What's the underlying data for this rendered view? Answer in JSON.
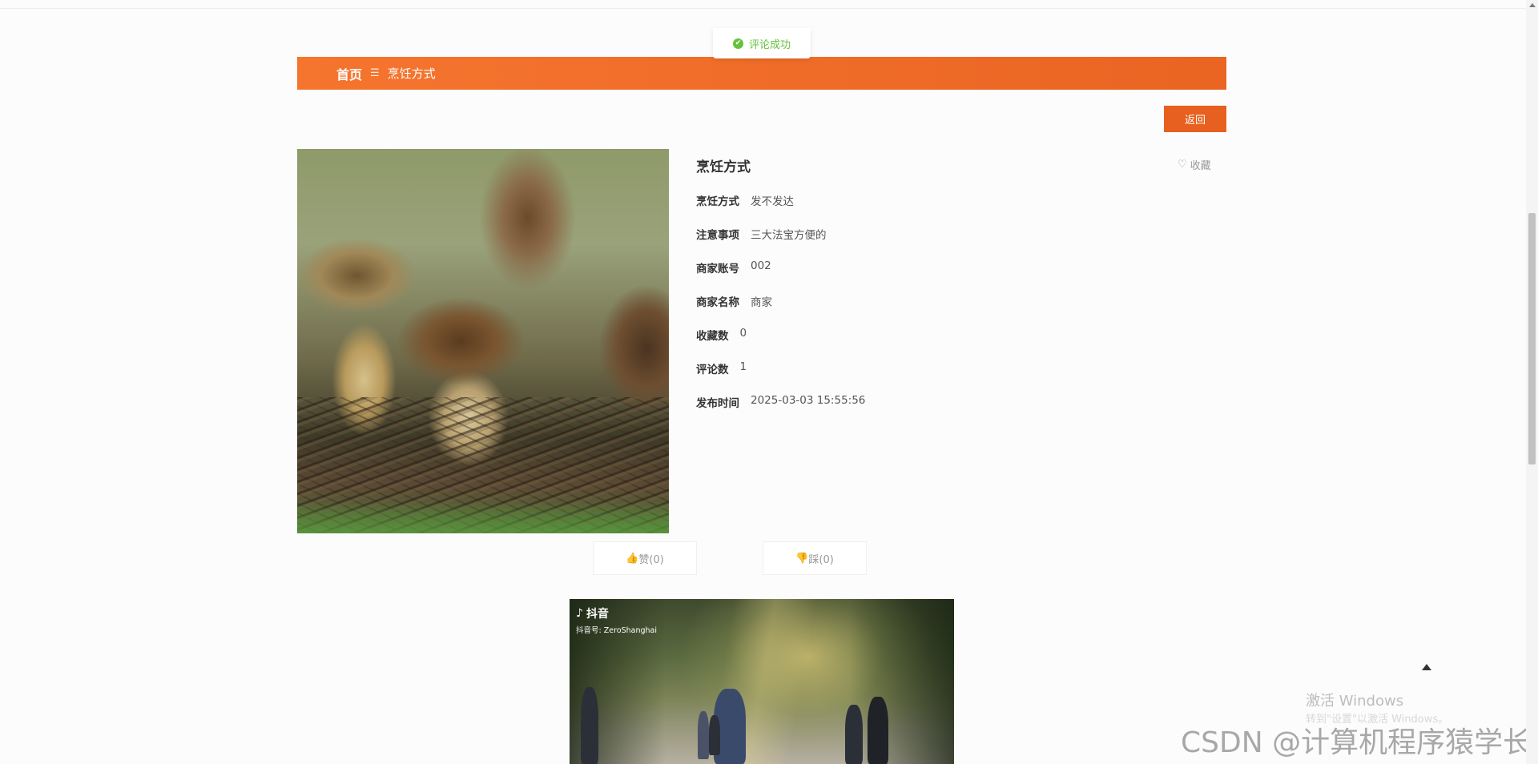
{
  "toast": {
    "message": "评论成功",
    "color": "#67c23a"
  },
  "breadcrumb": {
    "home": "首页",
    "separator": "☰",
    "current": "烹饪方式"
  },
  "actions": {
    "back_label": "返回",
    "favorite_label": "收藏"
  },
  "detail": {
    "title": "烹饪方式",
    "fields": [
      {
        "label": "烹饪方式",
        "value": "发不发达"
      },
      {
        "label": "注意事项",
        "value": "三大法宝方便的"
      },
      {
        "label": "商家账号",
        "value": "002"
      },
      {
        "label": "商家名称",
        "value": "商家"
      },
      {
        "label": "收藏数",
        "value": "0"
      },
      {
        "label": "评论数",
        "value": "1"
      },
      {
        "label": "发布时间",
        "value": "2025-03-03 15:55:56"
      }
    ]
  },
  "votes": {
    "like_label": "赞(0)",
    "dislike_label": "踩(0)"
  },
  "video": {
    "brand": "抖音",
    "handle": "抖音号: ZeroShanghai"
  },
  "watermarks": {
    "windows_title": "激活 Windows",
    "windows_hint": "转到\"设置\"以激活 Windows。",
    "csdn": "CSDN @计算机程序猿学长"
  },
  "colors": {
    "accent": "#e8601f",
    "success": "#67c23a"
  }
}
